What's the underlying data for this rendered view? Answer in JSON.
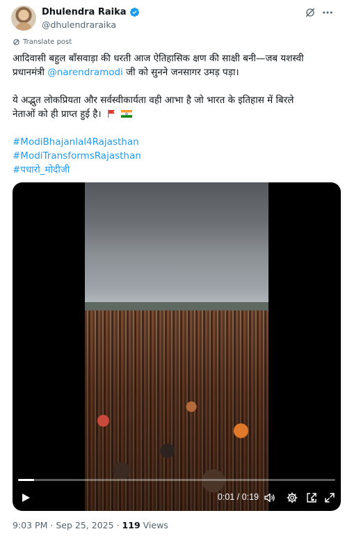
{
  "author": {
    "display_name": "Dhulendra Raika",
    "handle": "@dhulendraraika"
  },
  "translate_label": "Translate post",
  "text": {
    "line1a": "आदिवासी बहुल बाँसवाड़ा की धरती आज ऐतिहासिक क्षण की साक्षी बनी—जब यशस्वी",
    "line1b_pre": "प्रधानमंत्री ",
    "mention": "@narendramodi",
    "line1b_post": " जी को सुनने जनसागर उमड़ पड़ा।",
    "line2a": "ये अद्भुत लोकप्रियता और सर्वस्वीकार्यता वही आभा है जो भारत के इतिहास में बिरले",
    "line2b": "नेताओं को ही प्राप्त हुई है।",
    "hashtags": [
      "#ModiBhajanlal4Rajasthan",
      "#ModiTransformsRajasthan",
      "#पधारो_मोदीजी"
    ]
  },
  "video": {
    "time": "0:01 / 0:19",
    "progress": 0.05
  },
  "meta": {
    "time": "9:03 PM",
    "date": "Sep 25, 2025",
    "views": "119",
    "views_label": "Views",
    "sep": "·"
  }
}
